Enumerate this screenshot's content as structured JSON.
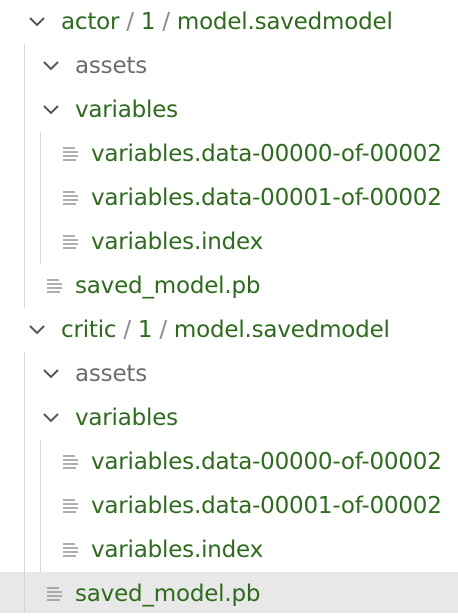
{
  "explorer": {
    "folders": [
      {
        "segments": [
          "actor",
          "1",
          "model.savedmodel"
        ],
        "children": {
          "assets": "assets",
          "variables": "variables",
          "files": [
            "variables.data-00000-of-00002",
            "variables.data-00001-of-00002",
            "variables.index"
          ],
          "saved_model": "saved_model.pb"
        }
      },
      {
        "segments": [
          "critic",
          "1",
          "model.savedmodel"
        ],
        "children": {
          "assets": "assets",
          "variables": "variables",
          "files": [
            "variables.data-00000-of-00002",
            "variables.data-00001-of-00002",
            "variables.index"
          ],
          "saved_model": "saved_model.pb"
        }
      }
    ],
    "path_separator": "/",
    "icons": {
      "expanded": "chevron-down-icon",
      "file": "file-lines-icon"
    },
    "colors": {
      "label_green": "#2f6b1f",
      "label_gray": "#6d6d6d",
      "separator_gray": "#8a8a8a",
      "hover_background": "#e8e8e8",
      "guide_line": "#d4d4d4"
    }
  }
}
